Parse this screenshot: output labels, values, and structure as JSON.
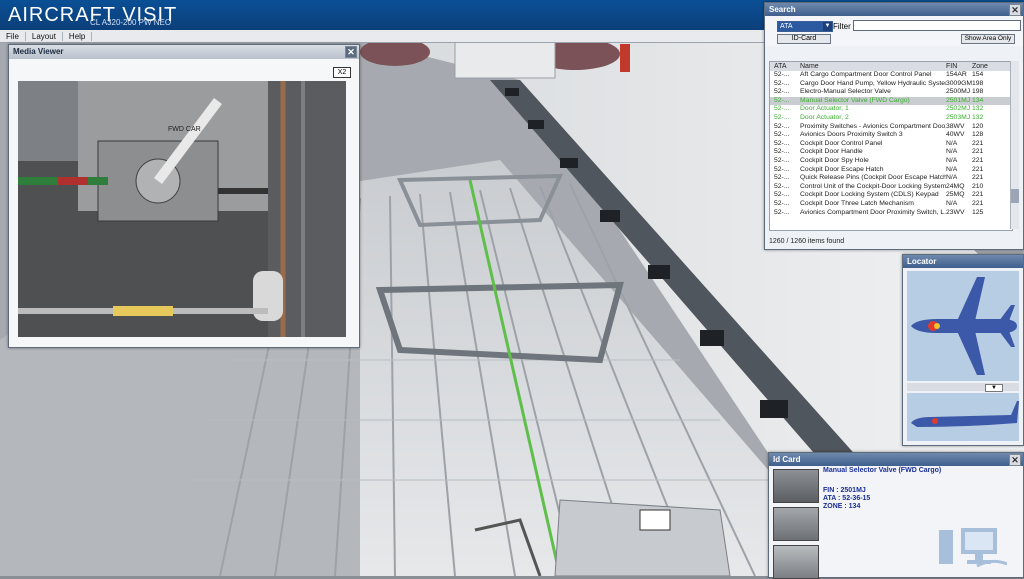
{
  "app": {
    "title_bold": "AIRCRAFT",
    "title_light": "VISIT",
    "subtitle": "CL A320-200 PW NEO"
  },
  "menu": [
    "File",
    "Layout",
    "Help"
  ],
  "media_viewer": {
    "title": "Media Viewer",
    "zoom_label": "X2",
    "photo_tag": "FWD CAR"
  },
  "search": {
    "title": "Search",
    "selected_filter": "ATA",
    "filter_label": "Filter :",
    "filter_value": "",
    "idcard_button": "ID-Card",
    "show_area_button": "Show Area Only",
    "columns": [
      "ATA",
      "Name",
      "FIN",
      "Zone"
    ],
    "rows": [
      {
        "ata": "52-...",
        "name": "Aft Cargo Compartment Door Control Panel",
        "fin": "154AR",
        "zone": "154",
        "style": "normal"
      },
      {
        "ata": "52-...",
        "name": "Cargo Door Hand Pump, Yellow Hydraulic System",
        "fin": "3009GM",
        "zone": "198",
        "style": "normal"
      },
      {
        "ata": "52-...",
        "name": "Electro-Manual Selector Valve",
        "fin": "2500MJ",
        "zone": "198",
        "style": "normal"
      },
      {
        "ata": "52-...",
        "name": "Manual Selector Valve (FWD Cargo)",
        "fin": "2501MJ",
        "zone": "134",
        "style": "selected"
      },
      {
        "ata": "52-...",
        "name": "Door Actuator, 1",
        "fin": "2502MJ",
        "zone": "132",
        "style": "green"
      },
      {
        "ata": "52-...",
        "name": "Door Actuator, 2",
        "fin": "2503MJ",
        "zone": "132",
        "style": "green"
      },
      {
        "ata": "52-...",
        "name": "Proximity Switches - Avionics Compartment Doo...",
        "fin": "38WV",
        "zone": "120",
        "style": "normal"
      },
      {
        "ata": "52-...",
        "name": "Avionics Doors Proximity Switch 3",
        "fin": "40WV",
        "zone": "128",
        "style": "normal"
      },
      {
        "ata": "52-...",
        "name": "Cockpit Door Control Panel",
        "fin": "N/A",
        "zone": "221",
        "style": "normal"
      },
      {
        "ata": "52-...",
        "name": "Cockpit Door Handle",
        "fin": "N/A",
        "zone": "221",
        "style": "normal"
      },
      {
        "ata": "52-...",
        "name": "Cockpit Door Spy Hole",
        "fin": "N/A",
        "zone": "221",
        "style": "normal"
      },
      {
        "ata": "52-...",
        "name": "Cockpit Door Escape Hatch",
        "fin": "N/A",
        "zone": "221",
        "style": "normal"
      },
      {
        "ata": "52-...",
        "name": "Quick Release Pins (Cockpit Door Escape Hatch)",
        "fin": "N/A",
        "zone": "221",
        "style": "normal"
      },
      {
        "ata": "52-...",
        "name": "Control Unit of the Cockpit-Door Locking System",
        "fin": "24MQ",
        "zone": "210",
        "style": "normal"
      },
      {
        "ata": "52-...",
        "name": "Cockpit Door Locking System (CDLS) Keypad",
        "fin": "25MQ",
        "zone": "221",
        "style": "normal"
      },
      {
        "ata": "52-...",
        "name": "Cockpit Door Three Latch Mechanism",
        "fin": "N/A",
        "zone": "221",
        "style": "normal"
      },
      {
        "ata": "52-...",
        "name": "Avionics Compartment Door Proximity Switch, L...",
        "fin": "23WV",
        "zone": "125",
        "style": "normal"
      }
    ],
    "count_text": "1260 / 1260 items found"
  },
  "locator": {
    "title": "Locator"
  },
  "id_card": {
    "title": "Id Card",
    "name": "Manual Selector Valve (FWD Cargo)",
    "fin": "FIN : 2501MJ",
    "ata": "ATA : 52-36-15",
    "zone": "ZONE : 134"
  },
  "colors": {
    "title_bar": "#0c3f7a",
    "highlight_green": "#3aae2f",
    "id_text": "#1b2f96",
    "locator_bg": "#b7cde3"
  }
}
